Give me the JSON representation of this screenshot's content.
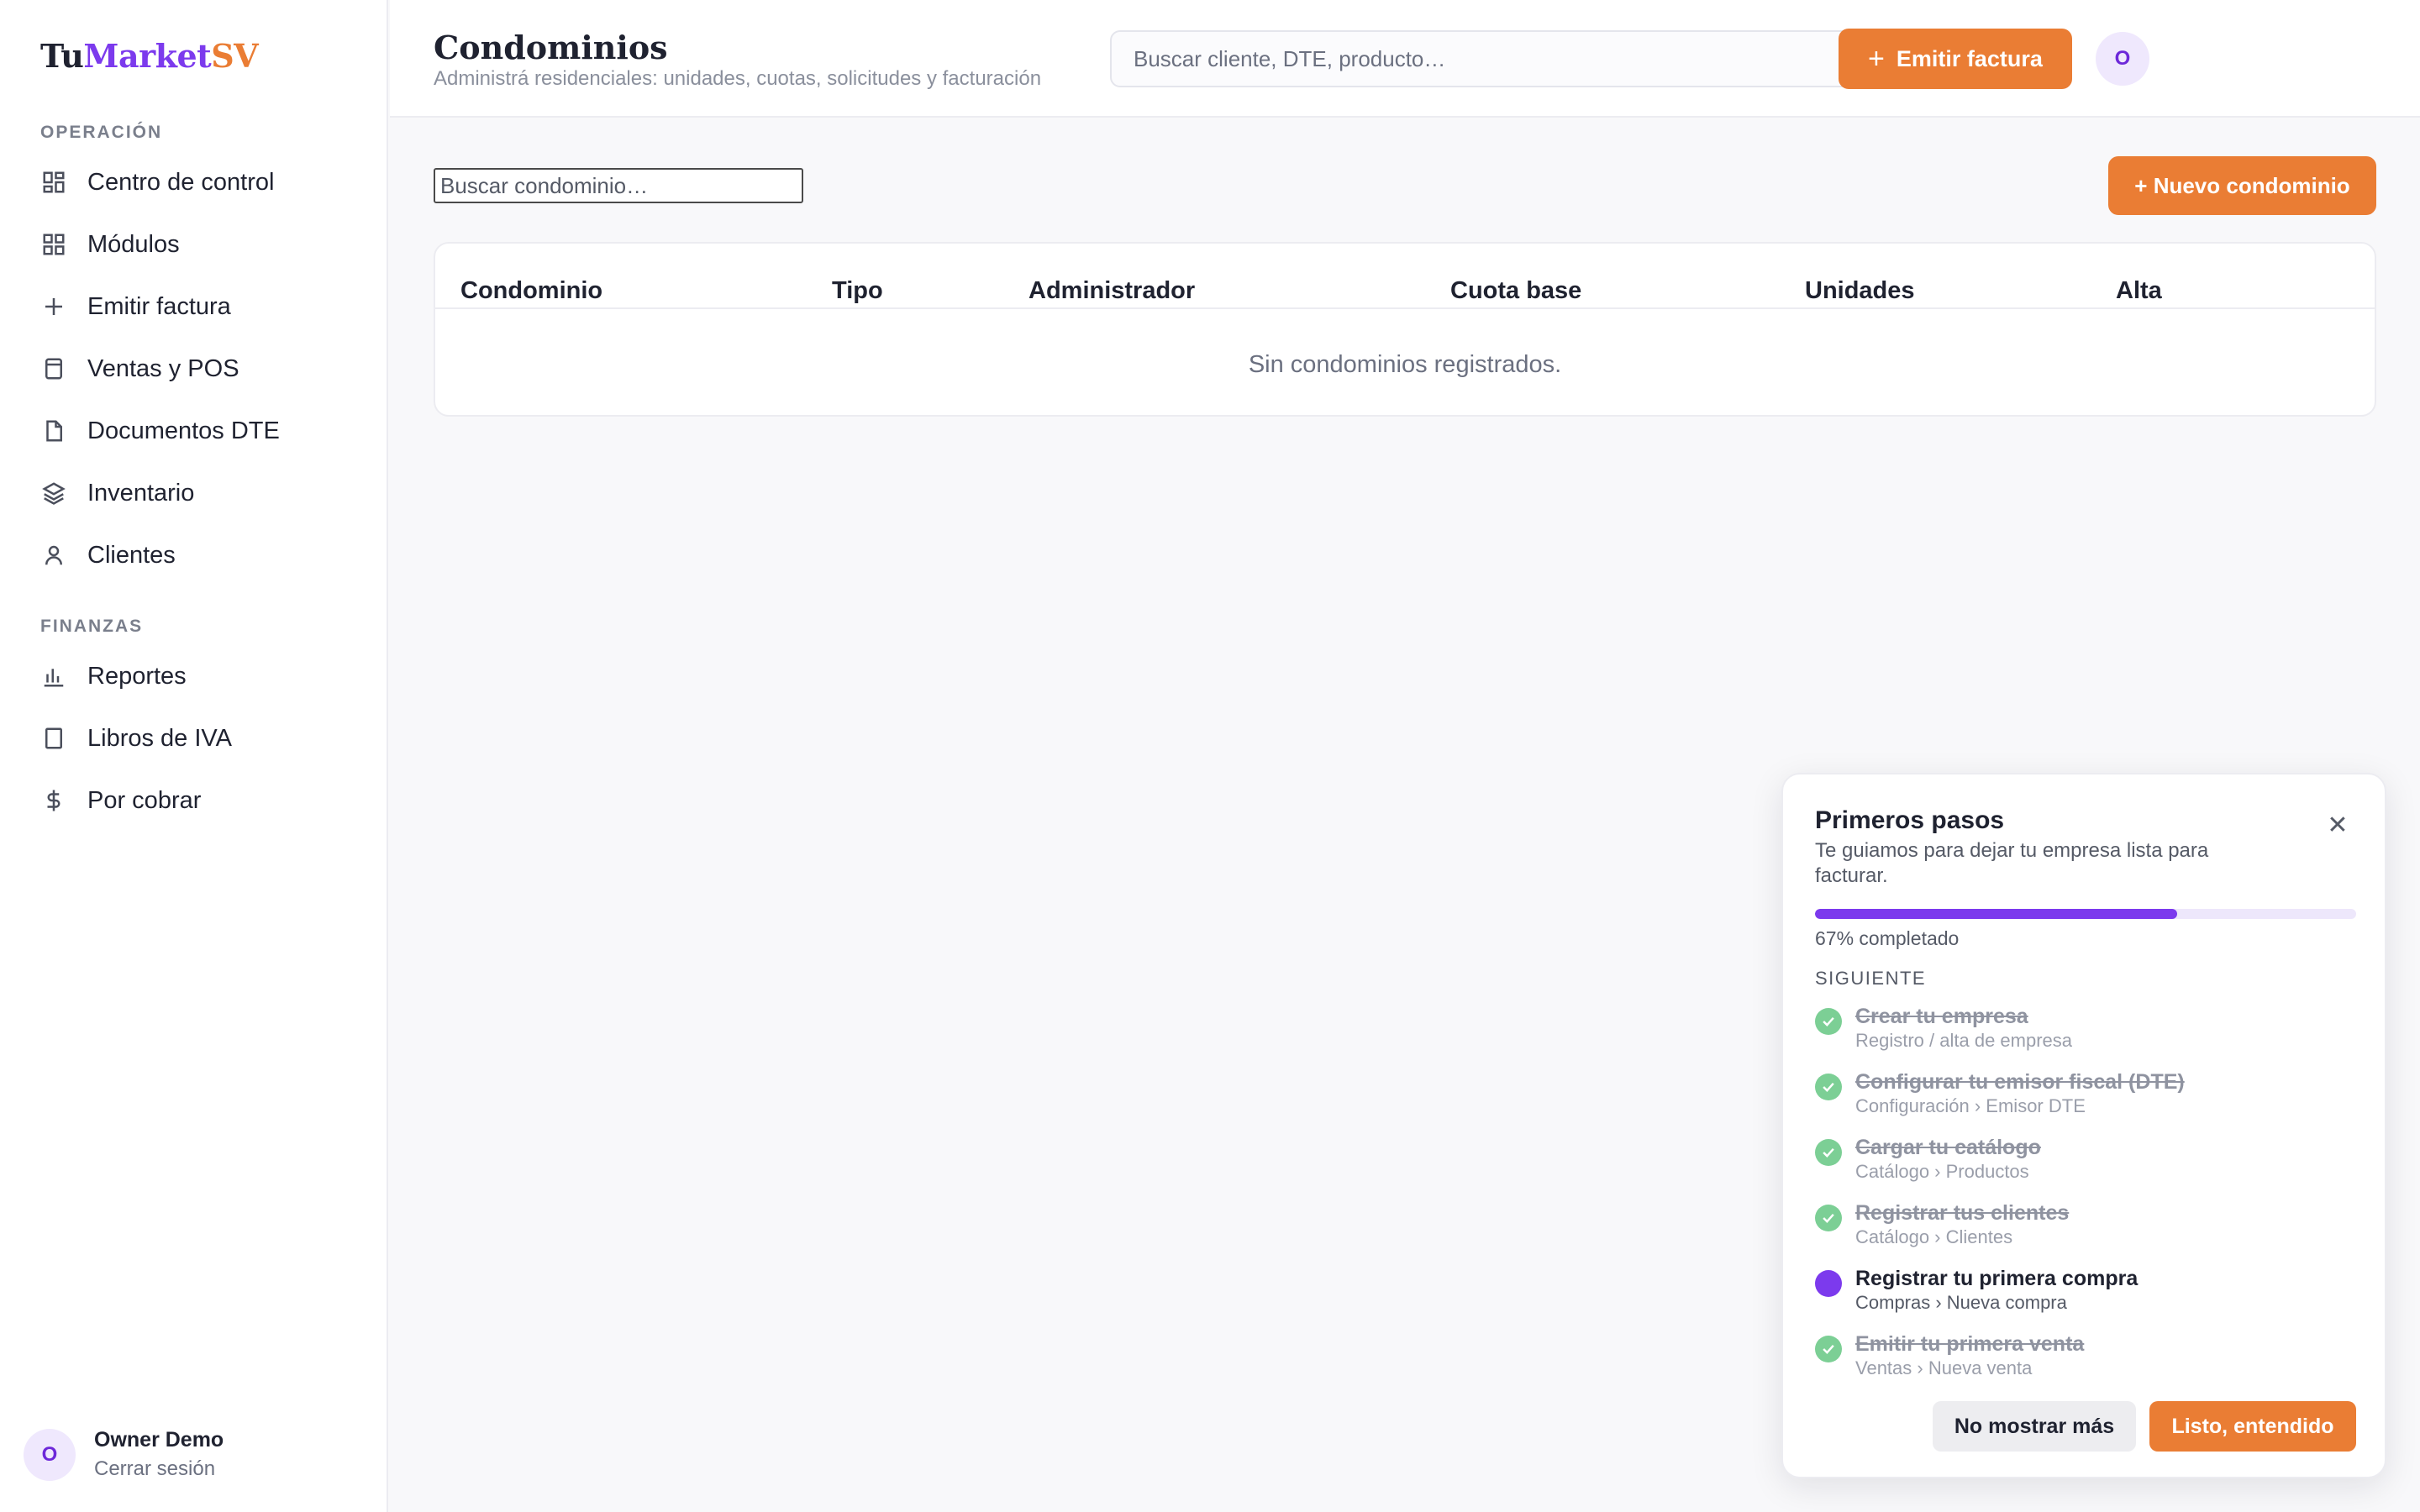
{
  "brand": {
    "part1": "Tu",
    "part2": "Market",
    "part3": "SV"
  },
  "sidebar": {
    "sections": [
      {
        "title": "OPERACIÓN",
        "items": [
          {
            "label": "Centro de control",
            "icon": "dashboard-icon"
          },
          {
            "label": "Módulos",
            "icon": "grid-icon"
          },
          {
            "label": "Emitir factura",
            "icon": "plus-icon"
          },
          {
            "label": "Ventas y POS",
            "icon": "register-icon"
          },
          {
            "label": "Documentos DTE",
            "icon": "document-icon"
          },
          {
            "label": "Inventario",
            "icon": "layers-icon"
          },
          {
            "label": "Clientes",
            "icon": "user-icon"
          }
        ]
      },
      {
        "title": "FINANZAS",
        "items": [
          {
            "label": "Reportes",
            "icon": "bar-chart-icon"
          },
          {
            "label": "Libros de IVA",
            "icon": "book-icon"
          },
          {
            "label": "Por cobrar",
            "icon": "dollar-icon"
          }
        ]
      }
    ],
    "user": {
      "initial": "O",
      "name": "Owner Demo",
      "logout": "Cerrar sesión"
    }
  },
  "header": {
    "title": "Condominios",
    "subtitle": "Administrá residenciales: unidades, cuotas, solicitudes y facturación",
    "search_placeholder": "Buscar cliente, DTE, producto…",
    "emit_label": "Emitir factura",
    "avatar_initial": "O"
  },
  "main": {
    "search_placeholder": "Buscar condominio…",
    "new_button": "+ Nuevo condominio",
    "table": {
      "columns": [
        "Condominio",
        "Tipo",
        "Administrador",
        "Cuota base",
        "Unidades",
        "Alta"
      ],
      "empty_message": "Sin condominios registrados."
    }
  },
  "onboarding": {
    "title": "Primeros pasos",
    "description": "Te guiamos para dejar tu empresa lista para facturar.",
    "progress": 0.67,
    "progress_text": "67% completado",
    "next_label": "SIGUIENTE",
    "steps": [
      {
        "title": "Crear tu empresa",
        "subtitle": "Registro / alta de empresa",
        "done": true
      },
      {
        "title": "Configurar tu emisor fiscal (DTE)",
        "subtitle": "Configuración › Emisor DTE",
        "done": true
      },
      {
        "title": "Cargar tu catálogo",
        "subtitle": "Catálogo › Productos",
        "done": true
      },
      {
        "title": "Registrar tus clientes",
        "subtitle": "Catálogo › Clientes",
        "done": true
      },
      {
        "title": "Registrar tu primera compra",
        "subtitle": "Compras › Nueva compra",
        "done": false
      },
      {
        "title": "Emitir tu primera venta",
        "subtitle": "Ventas › Nueva venta",
        "done": true
      }
    ],
    "dismiss_label": "No mostrar más",
    "confirm_label": "Listo, entendido"
  },
  "colors": {
    "accent": "#ea7d34",
    "brand_purple": "#7c3aed",
    "done_green": "#7ccf95"
  }
}
